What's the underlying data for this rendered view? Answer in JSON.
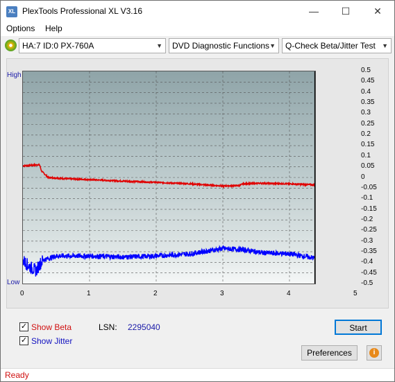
{
  "app": {
    "title": "PlexTools Professional XL V3.16",
    "icon_text": "XL"
  },
  "window_controls": {
    "minimize": "—",
    "maximize": "☐",
    "close": "✕"
  },
  "menu": {
    "options": "Options",
    "help": "Help"
  },
  "toolbar": {
    "drive": "HA:7 ID:0  PX-760A",
    "function": "DVD Diagnostic Functions",
    "test": "Q-Check Beta/Jitter Test"
  },
  "chart_data": {
    "type": "line",
    "xlim": [
      0,
      5
    ],
    "ylim": [
      -0.5,
      0.5
    ],
    "x_ticks": [
      "0",
      "1",
      "2",
      "3",
      "4",
      "5"
    ],
    "y_ticks": [
      "0.5",
      "0.45",
      "0.4",
      "0.35",
      "0.3",
      "0.25",
      "0.2",
      "0.15",
      "0.1",
      "0.05",
      "0",
      "-0.05",
      "-0.1",
      "-0.15",
      "-0.2",
      "-0.25",
      "-0.3",
      "-0.35",
      "-0.4",
      "-0.45",
      "-0.5"
    ],
    "left_labels": {
      "high": "High",
      "low": "Low"
    },
    "end_marker_x": 4.38,
    "series": [
      {
        "name": "Beta",
        "color": "#e00000",
        "x": [
          0,
          0.25,
          0.28,
          0.38,
          0.6,
          1.0,
          1.5,
          2.0,
          2.5,
          3.0,
          3.25,
          3.3,
          3.6,
          4.0,
          4.38
        ],
        "y": [
          0.055,
          0.06,
          0.03,
          0.0,
          -0.005,
          -0.01,
          -0.017,
          -0.023,
          -0.03,
          -0.04,
          -0.038,
          -0.03,
          -0.027,
          -0.03,
          -0.035
        ]
      },
      {
        "name": "Jitter",
        "color": "#0000ff",
        "x": [
          0,
          0.1,
          0.2,
          0.25,
          0.3,
          0.5,
          0.8,
          1.0,
          1.5,
          2.0,
          2.5,
          3.0,
          3.3,
          3.6,
          4.0,
          4.38
        ],
        "y": [
          -0.39,
          -0.42,
          -0.44,
          -0.41,
          -0.39,
          -0.37,
          -0.37,
          -0.37,
          -0.375,
          -0.37,
          -0.36,
          -0.335,
          -0.34,
          -0.355,
          -0.36,
          -0.38
        ]
      }
    ]
  },
  "bottom": {
    "show_beta": "Show Beta",
    "show_jitter": "Show Jitter",
    "lsn_label": "LSN:",
    "lsn_value": "2295040",
    "start": "Start",
    "preferences": "Preferences",
    "info": "i"
  },
  "status": {
    "text": "Ready"
  }
}
